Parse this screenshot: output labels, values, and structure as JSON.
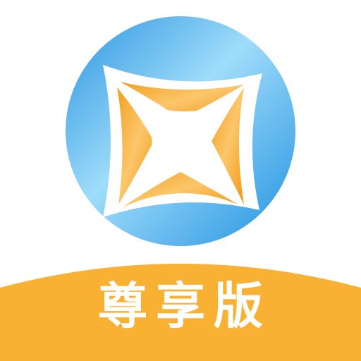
{
  "app_icon": {
    "edition_label": "尊享版",
    "colors": {
      "background": "#ffffff",
      "blue_light": "#8ed3f7",
      "blue_dark": "#1f8fde",
      "orange_light": "#fbc262",
      "orange_dark": "#ef9a14",
      "banner": "#f8b132",
      "label_text": "#ffffff"
    },
    "icons": {
      "logo": "ring-with-four-point-star-logo"
    }
  }
}
